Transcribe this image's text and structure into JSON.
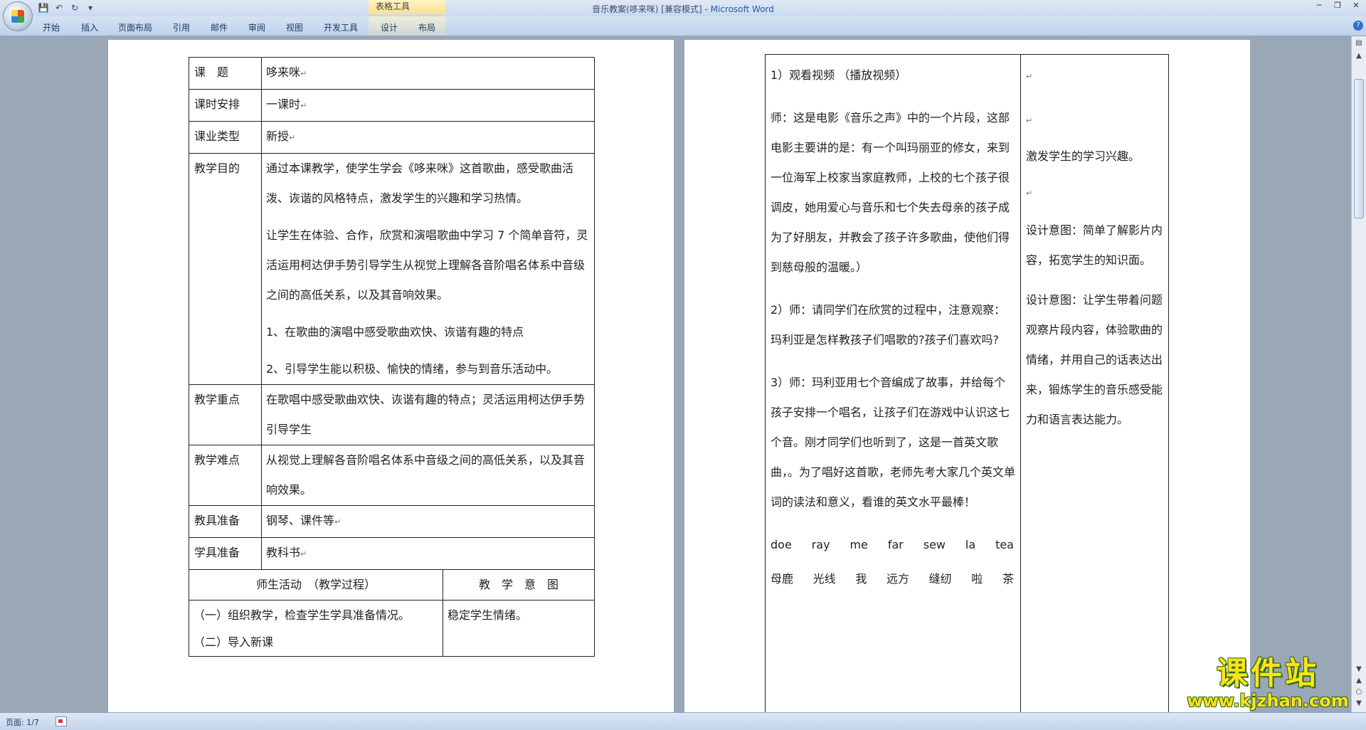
{
  "window": {
    "title_doc": "音乐教案(哆来咪) [兼容模式]",
    "title_sep": " - ",
    "title_app": "Microsoft Word",
    "context_tab_group": "表格工具"
  },
  "ribbon": {
    "tabs": [
      "开始",
      "插入",
      "页面布局",
      "引用",
      "邮件",
      "审阅",
      "视图",
      "开发工具",
      "设计",
      "布局"
    ]
  },
  "page1": {
    "rows": [
      {
        "label": "课　题",
        "content": [
          "哆来咪"
        ]
      },
      {
        "label": "课时安排",
        "content": [
          "一课时"
        ]
      },
      {
        "label": "课业类型",
        "content": [
          "新授"
        ]
      },
      {
        "label": "教学目的",
        "content": [
          "通过本课教学，使学生学会《哆来咪》这首歌曲，感受歌曲活泼、诙谐的风格特点，激发学生的兴趣和学习热情。",
          "让学生在体验、合作，欣赏和演唱歌曲中学习 7 个简单音符，灵活运用柯达伊手势引导学生从视觉上理解各音阶唱名体系中音级之间的高低关系，以及其音响效果。",
          "1、在歌曲的演唱中感受歌曲欢快、诙谐有趣的特点",
          "2、引导学生能以积极、愉快的情绪，参与到音乐活动中。"
        ]
      },
      {
        "label": "教学重点",
        "content": [
          "在歌唱中感受歌曲欢快、诙谐有趣的特点；灵活运用柯达伊手势引导学生"
        ]
      },
      {
        "label": "教学难点",
        "content": [
          "从视觉上理解各音阶唱名体系中音级之间的高低关系，以及其音响效果。"
        ]
      },
      {
        "label": "教具准备",
        "content": [
          "钢琴、课件等"
        ]
      },
      {
        "label": "学具准备",
        "content": [
          "教科书"
        ]
      }
    ],
    "header_activity": "师生活动　（教学过程）",
    "header_intent": "教　学　意　图",
    "activity_lines": [
      "（一）组织教学，检查学生学具准备情况。",
      "（二）导入新课"
    ],
    "intent_text": "稳定学生情绪。"
  },
  "page2": {
    "left_paras": [
      "1）观看视频 （播放视频）",
      "师：这是电影《音乐之声》中的一个片段，这部电影主要讲的是：有一个叫玛丽亚的修女，来到一位海军上校家当家庭教师，上校的七个孩子很调皮，她用爱心与音乐和七个失去母亲的孩子成为了好朋友，并教会了孩子许多歌曲，使他们得到慈母般的温暖。）",
      "2）师：请同学们在欣赏的过程中，注意观察：玛利亚是怎样教孩子们唱歌的?孩子们喜欢吗?",
      "3）师：玛利亚用七个音编成了故事，并给每个孩子安排一个唱名，让孩子们在游戏中认识这七个音。刚才同学们也听到了，这是一首英文歌曲，。为了唱好这首歌，老师先考大家几个英文单词的读法和意义，看谁的英文水平最棒！"
    ],
    "english_words": [
      "doe",
      "ray",
      "me",
      "far",
      "sew",
      "la",
      "tea"
    ],
    "chinese_words": [
      "母鹿",
      "光线",
      "我",
      "远方",
      "缝纫",
      "啦",
      "茶"
    ],
    "right_paras": [
      "激发学生的学习兴趣。",
      "设计意图：简单了解影片内容，拓宽学生的知识面。",
      "设计意图：让学生带着问题观察片段内容，体验歌曲的情绪，并用自己的话表达出来，锻炼学生的音乐感受能力和语言表达能力。"
    ]
  },
  "status": {
    "page": "页面: 1/7"
  },
  "watermark": {
    "main": "课件站",
    "url": "www.kjzhan.com"
  }
}
